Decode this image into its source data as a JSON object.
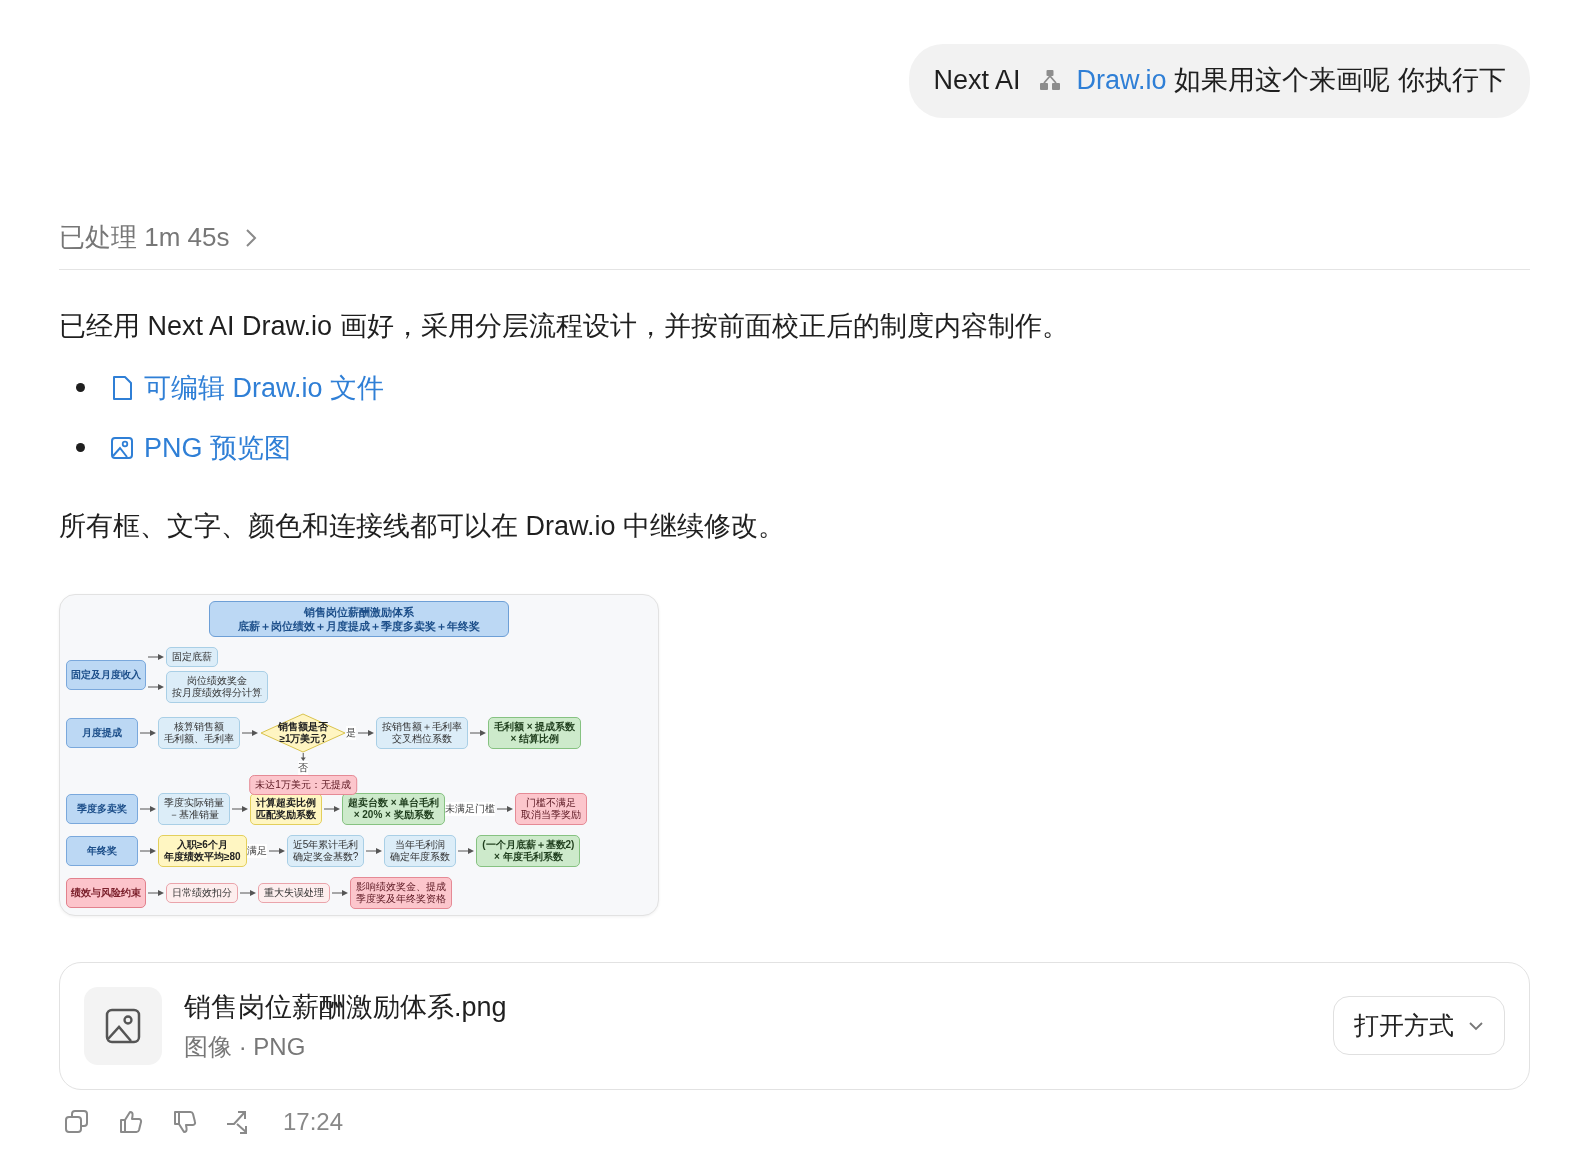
{
  "user_message": {
    "prefix": "Next AI",
    "link": "Draw.io",
    "text": "如果用这个来画呢 你执行下"
  },
  "processing": {
    "label": "已处理 1m 45s"
  },
  "response": {
    "intro": "已经用 Next AI Draw.io 画好，采用分层流程设计，并按前面校正后的制度内容制作。",
    "links": [
      {
        "kind": "file",
        "label": "可编辑 Draw.io 文件"
      },
      {
        "kind": "image",
        "label": "PNG 预览图"
      }
    ],
    "note": "所有框、文字、颜色和连接线都可以在 Draw.io 中继续修改。"
  },
  "diagram": {
    "title": [
      "销售岗位薪酬激励体系",
      "底薪＋岗位绩效＋月度提成＋季度多卖奖＋年终奖"
    ],
    "rows": [
      {
        "kind": "fork",
        "lane": {
          "kind": "lane",
          "lines": [
            "固定及月度收入"
          ]
        },
        "steps": [
          {
            "kind": "step",
            "lines": [
              "固定底薪"
            ]
          },
          {
            "kind": "step",
            "lines": [
              "岗位绩效奖金",
              "按月度绩效得分计算"
            ]
          }
        ]
      },
      {
        "kind": "chain",
        "lane": {
          "kind": "lane",
          "lines": [
            "月度提成"
          ]
        },
        "steps": [
          {
            "kind": "step",
            "lines": [
              "核算销售额",
              "毛利额、毛利率"
            ]
          },
          {
            "kind": "decision",
            "lines": [
              "销售额是否",
              "≥1万美元?"
            ],
            "below": {
              "edge_label": "否",
              "kind": "alert",
              "lines": [
                "未达1万美元：无提成"
              ]
            }
          },
          {
            "kind": "step",
            "edge_label": "是",
            "lines": [
              "按销售额＋毛利率",
              "交叉档位系数"
            ]
          },
          {
            "kind": "result",
            "lines": [
              "毛利额 × 提成系数",
              "× 结算比例"
            ]
          }
        ]
      },
      {
        "kind": "chain",
        "lane": {
          "kind": "lane",
          "lines": [
            "季度多卖奖"
          ]
        },
        "steps": [
          {
            "kind": "step",
            "lines": [
              "季度实际销量",
              "－基准销量"
            ]
          },
          {
            "kind": "check",
            "lines": [
              "计算超卖比例",
              "匹配奖励系数"
            ]
          },
          {
            "kind": "result",
            "lines": [
              "超卖台数 × 单台毛利",
              "× 20% × 奖励系数"
            ]
          },
          {
            "kind": "alert",
            "edge_label": "未满足门槛",
            "lines": [
              "门槛不满足",
              "取消当季奖励"
            ]
          }
        ]
      },
      {
        "kind": "chain",
        "lane": {
          "kind": "lane",
          "lines": [
            "年终奖"
          ]
        },
        "steps": [
          {
            "kind": "check",
            "lines": [
              "入职≥6个月",
              "年度绩效平均≥80"
            ]
          },
          {
            "kind": "step",
            "edge_label": "满足",
            "lines": [
              "近5年累计毛利",
              "确定奖金基数?"
            ]
          },
          {
            "kind": "step",
            "lines": [
              "当年毛利润",
              "确定年度系数"
            ]
          },
          {
            "kind": "result",
            "lines": [
              "(一个月底薪＋基数2)",
              "× 年度毛利系数"
            ]
          }
        ]
      },
      {
        "kind": "chain",
        "lane": {
          "kind": "risk_lane",
          "lines": [
            "绩效与风险约束"
          ]
        },
        "steps": [
          {
            "kind": "risk_step",
            "lines": [
              "日常绩效扣分"
            ]
          },
          {
            "kind": "risk_step",
            "lines": [
              "重大失误处理"
            ]
          },
          {
            "kind": "alert",
            "lines": [
              "影响绩效奖金、提成",
              "季度奖及年终奖资格"
            ]
          }
        ]
      }
    ]
  },
  "file_card": {
    "name": "销售岗位薪酬激励体系.png",
    "meta": "图像 · PNG",
    "open_button": "打开方式"
  },
  "footer": {
    "time": "17:24"
  }
}
